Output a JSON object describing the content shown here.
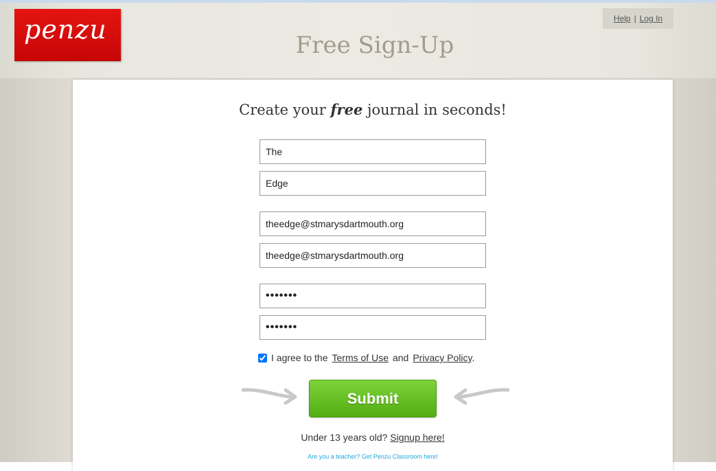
{
  "brand": {
    "logo_text": "penzu",
    "logo_color": "#d90b0b"
  },
  "nav": {
    "help": "Help",
    "separator": "|",
    "login": "Log In"
  },
  "page": {
    "title": "Free Sign-Up"
  },
  "form": {
    "headline_pre": "Create your",
    "headline_em": "free",
    "headline_post": "journal in seconds!",
    "first_name": "The",
    "last_name": "Edge",
    "email": "theedge@stmarysdartmouth.org",
    "email_confirm": "theedge@stmarysdartmouth.org",
    "password_mask": "•••••••",
    "password_confirm_mask": "•••••••",
    "agree": {
      "checked": true,
      "pre": "I agree to the",
      "terms": "Terms of Use",
      "and": "and",
      "privacy": "Privacy Policy",
      "post": "."
    },
    "submit_label": "Submit",
    "submit_color": "#5bb81c"
  },
  "footer": {
    "under13_text": "Under 13 years old?",
    "under13_link": "Signup here!",
    "teacher_link": "Are you a teacher? Get Penzu Classroom here!"
  }
}
